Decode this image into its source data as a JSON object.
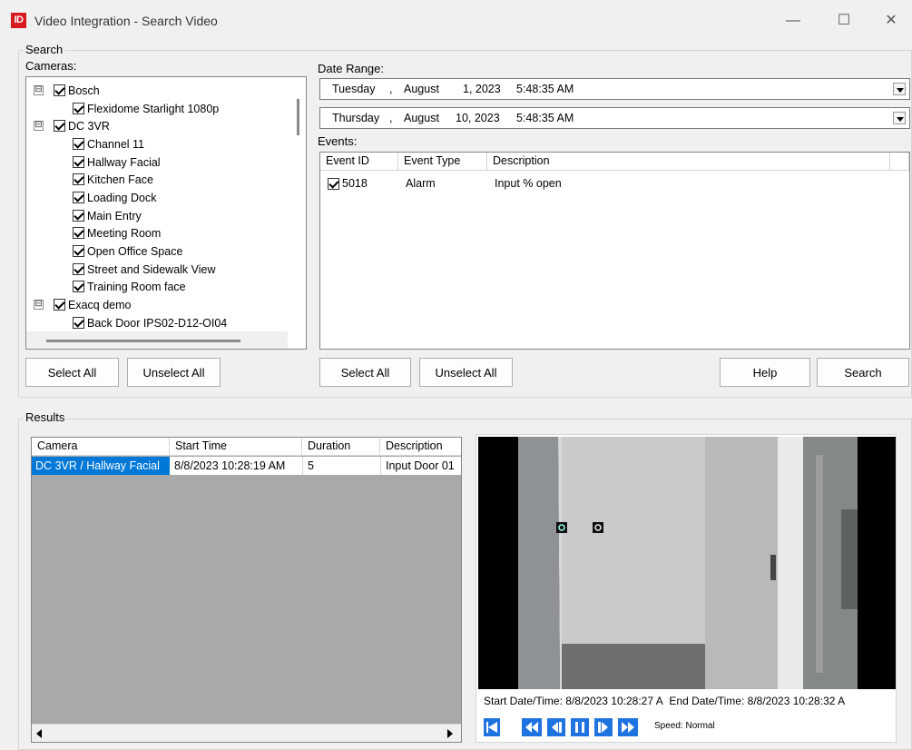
{
  "window": {
    "title": "Video Integration - Search Video",
    "icon_text": "ID",
    "minimize_glyph": "—",
    "maximize_glyph": "☐",
    "close_glyph": "✕"
  },
  "search": {
    "legend": "Search",
    "cameras_label": "Cameras:",
    "tree": [
      {
        "label": "Bosch",
        "level": 0,
        "expander": "⊟",
        "checked": true
      },
      {
        "label": "Flexidome Starlight 1080p",
        "level": 1,
        "checked": true
      },
      {
        "label": "DC 3VR",
        "level": 0,
        "expander": "⊟",
        "checked": true
      },
      {
        "label": "Channel 11",
        "level": 1,
        "checked": true
      },
      {
        "label": "Hallway Facial",
        "level": 1,
        "checked": true
      },
      {
        "label": "Kitchen Face",
        "level": 1,
        "checked": true
      },
      {
        "label": "Loading Dock",
        "level": 1,
        "checked": true
      },
      {
        "label": "Main Entry",
        "level": 1,
        "checked": true
      },
      {
        "label": "Meeting Room",
        "level": 1,
        "checked": true
      },
      {
        "label": "Open Office Space",
        "level": 1,
        "checked": true
      },
      {
        "label": "Street and Sidewalk View",
        "level": 1,
        "checked": true
      },
      {
        "label": "Training Room face",
        "level": 1,
        "checked": true
      },
      {
        "label": "Exacq demo",
        "level": 0,
        "expander": "⊟",
        "checked": true
      },
      {
        "label": "Back Door IPS02-D12-OI04",
        "level": 1,
        "checked": true
      }
    ],
    "cameras_select_all": "Select All",
    "cameras_unselect_all": "Unselect All",
    "date_range_label": "Date Range:",
    "date_from": {
      "weekday": "Tuesday",
      "sep": ",",
      "month": "August",
      "day_year": "1, 2023",
      "time": "5:48:35 AM"
    },
    "date_to": {
      "weekday": "Thursday",
      "sep": ",",
      "month": "August",
      "day_year": "10, 2023",
      "time": "5:48:35 AM"
    },
    "events_label": "Events:",
    "events_columns": [
      "Event ID",
      "Event Type",
      "Description"
    ],
    "events_rows": [
      {
        "event_id": "5018",
        "event_type": "Alarm",
        "description": "Input % open",
        "checked": true
      }
    ],
    "events_select_all": "Select All",
    "events_unselect_all": "Unselect All",
    "help": "Help",
    "search_button": "Search"
  },
  "results": {
    "legend": "Results",
    "columns": [
      "Camera",
      "Start Time",
      "Duration",
      "Description"
    ],
    "rows": [
      {
        "camera": "DC 3VR / Hallway Facial",
        "start_time": "8/8/2023 10:28:19 AM",
        "duration": "5",
        "description": "Input Door 01",
        "selected": true
      }
    ]
  },
  "player": {
    "start_label": "Start Date/Time:",
    "start_value": "8/8/2023 10:28:27 A",
    "end_label": "End Date/Time:",
    "end_value": "8/8/2023 10:28:32 A",
    "speed_label": "Speed:",
    "speed_value": "Normal",
    "controls": [
      "skip-to-start-icon",
      "rewind-fast-icon",
      "step-back-icon",
      "pause-icon",
      "step-forward-icon",
      "fast-forward-icon"
    ]
  },
  "colors": {
    "accent": "#0078d7",
    "selection": "#0078d7",
    "playback": "#1f73e0",
    "app_icon": "#d71920"
  }
}
